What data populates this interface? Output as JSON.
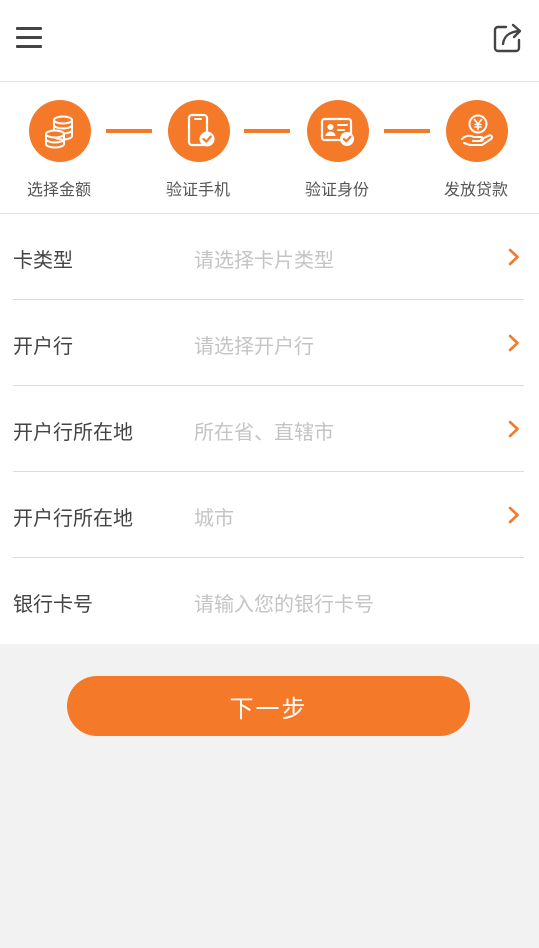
{
  "steps": [
    {
      "label": "选择金额",
      "icon": "coins-icon"
    },
    {
      "label": "验证手机",
      "icon": "phone-check-icon"
    },
    {
      "label": "验证身份",
      "icon": "id-card-check-icon"
    },
    {
      "label": "发放贷款",
      "icon": "yen-hand-icon"
    }
  ],
  "form": {
    "rows": [
      {
        "label": "卡类型",
        "placeholder": "请选择卡片类型",
        "has_chevron": true
      },
      {
        "label": "开户行",
        "placeholder": "请选择开户行",
        "has_chevron": true
      },
      {
        "label": "开户行所在地",
        "placeholder": "所在省、直辖市",
        "has_chevron": true
      },
      {
        "label": "开户行所在地",
        "placeholder": "城市",
        "has_chevron": true
      },
      {
        "label": "银行卡号",
        "placeholder": "请输入您的银行卡号",
        "has_chevron": false
      }
    ]
  },
  "next_button": {
    "label": "下一步"
  },
  "colors": {
    "accent": "#f47a2a",
    "background": "#f2f2f2",
    "placeholder": "#c4c4c4"
  }
}
